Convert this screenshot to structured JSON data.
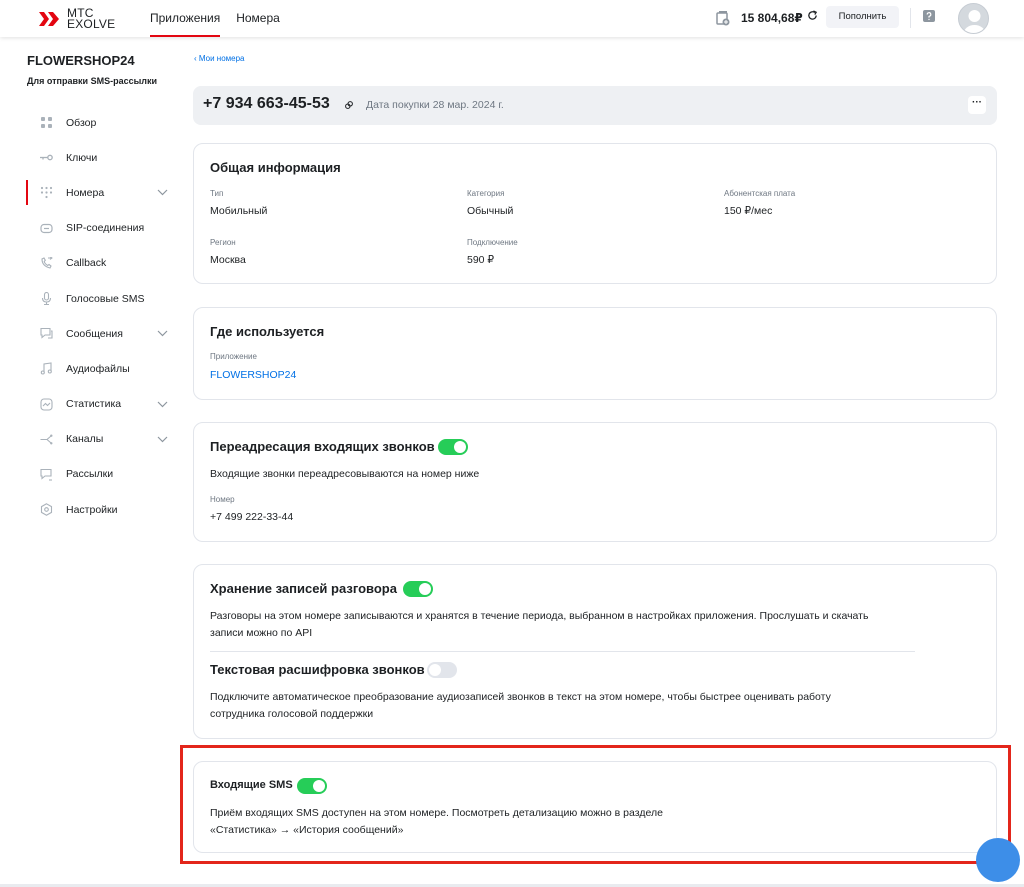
{
  "header": {
    "logo_line1": "МТС",
    "logo_line2": "EXOLVE",
    "nav": [
      "Приложения",
      "Номера"
    ],
    "balance": "15 804,68₽",
    "topup_label": "Пополнить",
    "brand_color": "#e30611"
  },
  "sidebar": {
    "app_title": "FLOWERSHOP24",
    "app_subtitle": "Для отправки SMS-рассылки",
    "items": [
      {
        "label": "Обзор",
        "icon": "overview-icon"
      },
      {
        "label": "Ключи",
        "icon": "key-icon"
      },
      {
        "label": "Номера",
        "icon": "dialpad-icon"
      },
      {
        "label": "SIP-соединения",
        "icon": "sip-icon"
      },
      {
        "label": "Callback",
        "icon": "callback-icon"
      },
      {
        "label": "Голосовые SMS",
        "icon": "microphone-icon"
      },
      {
        "label": "Сообщения",
        "icon": "chat-icon"
      },
      {
        "label": "Аудиофайлы",
        "icon": "music-icon"
      },
      {
        "label": "Статистика",
        "icon": "stats-icon"
      },
      {
        "label": "Каналы",
        "icon": "channels-icon"
      },
      {
        "label": "Рассылки",
        "icon": "mailing-icon"
      },
      {
        "label": "Настройки",
        "icon": "settings-icon"
      }
    ]
  },
  "main": {
    "breadcrumb": "Мои номера",
    "number": "+7 934 663-45-53",
    "purchase_date": "Дата покупки  28 мар. 2024 г.",
    "more_label": "···",
    "general": {
      "title": "Общая информация",
      "type_label": "Тип",
      "type_value": "Мобильный",
      "category_label": "Категория",
      "category_value": "Обычный",
      "fee_label": "Абонентская плата",
      "fee_value": "150 ₽/мес",
      "region_label": "Регион",
      "region_value": "Москва",
      "connect_label": "Подключение",
      "connect_value": "590 ₽"
    },
    "usage": {
      "title": "Где используется",
      "app_label": "Приложение",
      "app_value": "FLOWERSHOP24"
    },
    "forwarding": {
      "title": "Переадресация входящих звонков",
      "enabled": true,
      "description": "Входящие звонки переадресовываются на номер ниже",
      "number_label": "Номер",
      "number_value": "+7 499 222-33-44"
    },
    "recording": {
      "title": "Хранение записей разговора",
      "enabled": true,
      "description_line1": "Разговоры на этом номере записываются и хранятся в течение периода, выбранном в настройках приложения. Прослушать и скачать",
      "description_line2": "записи можно по API",
      "transcription_title": "Текстовая расшифровка звонков",
      "transcription_enabled": false,
      "transcription_line1": "Подключите автоматическое преобразование аудиозаписей звонков в текст на этом номере, чтобы быстрее оценивать работу",
      "transcription_line2": "сотрудника голосовой поддержки"
    },
    "incoming_sms": {
      "title": "Входящие SMS",
      "enabled": true,
      "description_line1": "Приём входящих SMS доступен на этом номере. Посмотреть детализацию можно в разделе",
      "description_line2": "«Статистика» → «История сообщений»"
    }
  }
}
